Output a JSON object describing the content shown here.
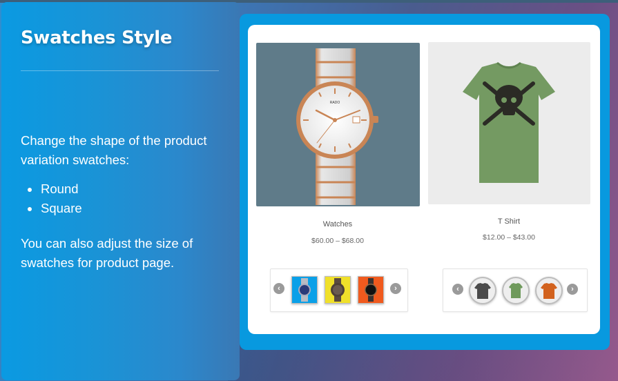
{
  "panel": {
    "title": "Swatches Style",
    "description": "Change the shape of the product variation swatches:",
    "shapes": [
      "Round",
      "Square"
    ],
    "note": "You can also adjust the size of swatches for product page."
  },
  "products": [
    {
      "name": "Watches",
      "price": "$60.00 – $68.00",
      "image": "rose-gold-watch",
      "swatch_style": "square",
      "swatches": [
        {
          "label": "blue-dial-watch",
          "color": "#0aa0e8"
        },
        {
          "label": "bronze-watch",
          "color": "#f0e02a"
        },
        {
          "label": "black-dial-watch",
          "color": "#f05a1e"
        }
      ]
    },
    {
      "name": "T Shirt",
      "price": "$12.00 – $43.00",
      "image": "green-skull-tshirt",
      "swatch_style": "round",
      "swatches": [
        {
          "label": "dark-grey-tshirt",
          "color": "#4a4a4a"
        },
        {
          "label": "green-tshirt",
          "color": "#6f9a5c"
        },
        {
          "label": "orange-tshirt",
          "color": "#d2621e"
        }
      ]
    }
  ],
  "icons": {
    "prev": "‹",
    "next": "›"
  },
  "colors": {
    "accent": "#0899df",
    "panel_blue": "#0a9ae2",
    "card_bg": "#ffffff"
  }
}
